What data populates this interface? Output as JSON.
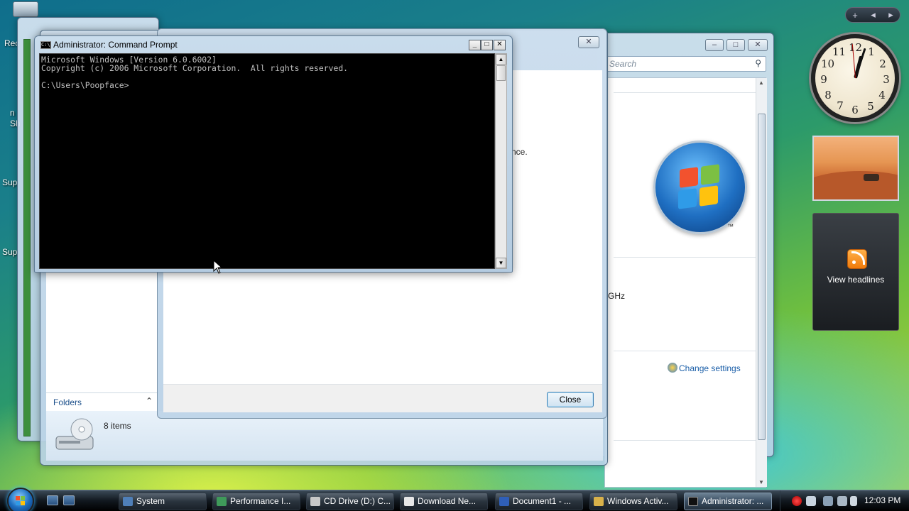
{
  "desktop": {
    "labels": [
      "Rec",
      "Sup",
      "Sup",
      "n",
      "Sh"
    ]
  },
  "sidebar": {
    "controls": [
      "+",
      "◂",
      "▸"
    ],
    "clock_numbers": [
      "12",
      "1",
      "2",
      "3",
      "4",
      "5",
      "6",
      "7",
      "8",
      "9",
      "10",
      "11"
    ],
    "feeds_label": "View headlines"
  },
  "sysprops": {
    "search_placeholder": "Search",
    "partial_text_ghz": "GHz",
    "partial_text_nce": "nce.",
    "change_settings": "Change settings",
    "tm": "™"
  },
  "explorer": {
    "folders_label": "Folders",
    "items_count": "8 items"
  },
  "dialog": {
    "close_label": "Close"
  },
  "cmd": {
    "title": "Administrator: Command Prompt",
    "icon_text": "C:\\",
    "lines": [
      "Microsoft Windows [Version 6.0.6002]",
      "Copyright (c) 2006 Microsoft Corporation.  All rights reserved.",
      "",
      "C:\\Users\\Poopface>"
    ],
    "scroll_up": "▲",
    "scroll_down": "▼"
  },
  "taskbar": {
    "tasks": [
      {
        "label": "System",
        "icon_color": "#4f7fb8"
      },
      {
        "label": "Performance I...",
        "icon_color": "#3f9a5a"
      },
      {
        "label": "CD Drive (D:) C...",
        "icon_color": "#c8c8c8"
      },
      {
        "label": "Download Ne...",
        "icon_color": "#e7e7e7"
      },
      {
        "label": "Document1 - ...",
        "icon_color": "#2f5fb8"
      },
      {
        "label": "Windows Activ...",
        "icon_color": "#d8b14a"
      },
      {
        "label": "Administrator: ...",
        "icon_color": "#111111"
      }
    ],
    "time": "12:03 PM"
  },
  "colors": {
    "accent": "#1b4f8a",
    "link": "#1a5ea8"
  }
}
